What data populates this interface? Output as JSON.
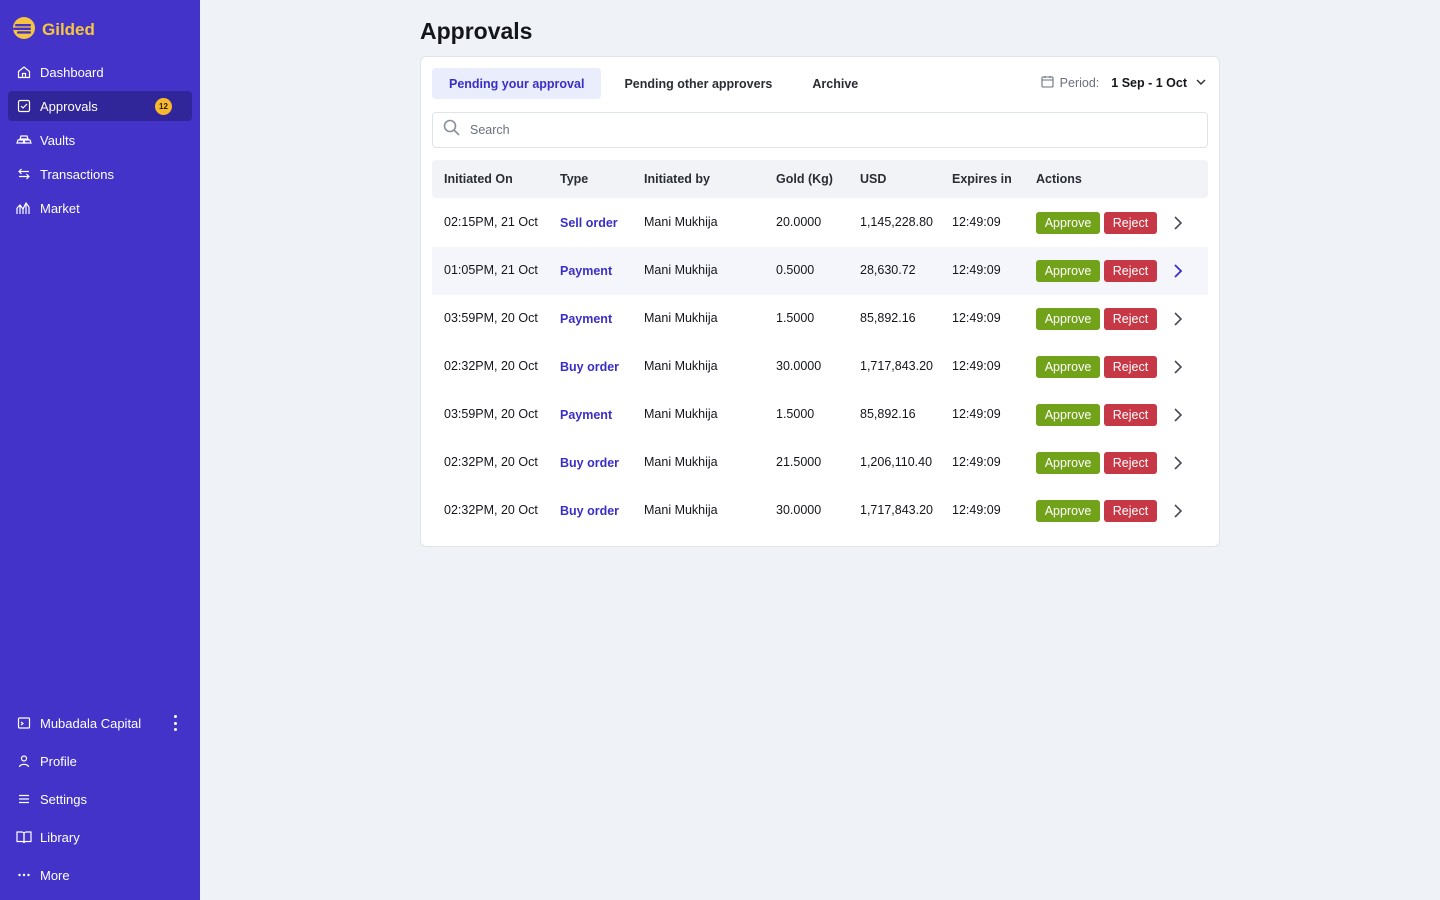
{
  "app": {
    "name": "Gilded",
    "brand_color": "#f5c542",
    "sidebar_color": "#4333c9"
  },
  "sidebar": {
    "items": [
      {
        "label": "Dashboard",
        "icon": "home-icon"
      },
      {
        "label": "Approvals",
        "icon": "approvals-icon",
        "badge": "12",
        "active": true
      },
      {
        "label": "Vaults",
        "icon": "vault-icon"
      },
      {
        "label": "Transactions",
        "icon": "transfer-icon"
      },
      {
        "label": "Market",
        "icon": "market-chart-icon"
      }
    ],
    "org": {
      "label": "Mubadala Capital",
      "icon": "terminal-icon"
    },
    "bottom": [
      {
        "label": "Profile",
        "icon": "user-icon"
      },
      {
        "label": "Settings",
        "icon": "menu-lines-icon"
      },
      {
        "label": "Library",
        "icon": "book-icon"
      },
      {
        "label": "More",
        "icon": "ellipsis-icon"
      }
    ]
  },
  "page": {
    "title": "Approvals"
  },
  "tabs": [
    {
      "label": "Pending your approval",
      "active": true
    },
    {
      "label": "Pending other approvers"
    },
    {
      "label": "Archive"
    }
  ],
  "period": {
    "label": "Period:",
    "value": "1 Sep - 1 Oct"
  },
  "search": {
    "placeholder": "Search",
    "value": ""
  },
  "table": {
    "columns": [
      "Initiated On",
      "Type",
      "Initiated by",
      "Gold (Kg)",
      "USD",
      "Expires in",
      "Actions"
    ],
    "approve_label": "Approve",
    "reject_label": "Reject",
    "rows": [
      {
        "initiated_on": "02:15PM, 21 Oct",
        "type": "Sell order",
        "initiated_by": "Mani Mukhija",
        "gold": "20.0000",
        "usd": "1,145,228.80",
        "expires": "12:49:09"
      },
      {
        "initiated_on": "01:05PM, 21 Oct",
        "type": "Payment",
        "initiated_by": "Mani Mukhija",
        "gold": "0.5000",
        "usd": "28,630.72",
        "expires": "12:49:09"
      },
      {
        "initiated_on": "03:59PM, 20 Oct",
        "type": "Payment",
        "initiated_by": "Mani Mukhija",
        "gold": "1.5000",
        "usd": "85,892.16",
        "expires": "12:49:09"
      },
      {
        "initiated_on": "02:32PM, 20 Oct",
        "type": "Buy order",
        "initiated_by": "Mani Mukhija",
        "gold": "30.0000",
        "usd": "1,717,843.20",
        "expires": "12:49:09"
      },
      {
        "initiated_on": "03:59PM, 20 Oct",
        "type": "Payment",
        "initiated_by": "Mani Mukhija",
        "gold": "1.5000",
        "usd": "85,892.16",
        "expires": "12:49:09"
      },
      {
        "initiated_on": "02:32PM, 20 Oct",
        "type": "Buy order",
        "initiated_by": "Mani Mukhija",
        "gold": "21.5000",
        "usd": "1,206,110.40",
        "expires": "12:49:09"
      },
      {
        "initiated_on": "02:32PM, 20 Oct",
        "type": "Buy order",
        "initiated_by": "Mani Mukhija",
        "gold": "30.0000",
        "usd": "1,717,843.20",
        "expires": "12:49:09"
      }
    ]
  },
  "colors": {
    "approve": "#72a21a",
    "reject": "#c73847",
    "link": "#3a2fc4"
  }
}
